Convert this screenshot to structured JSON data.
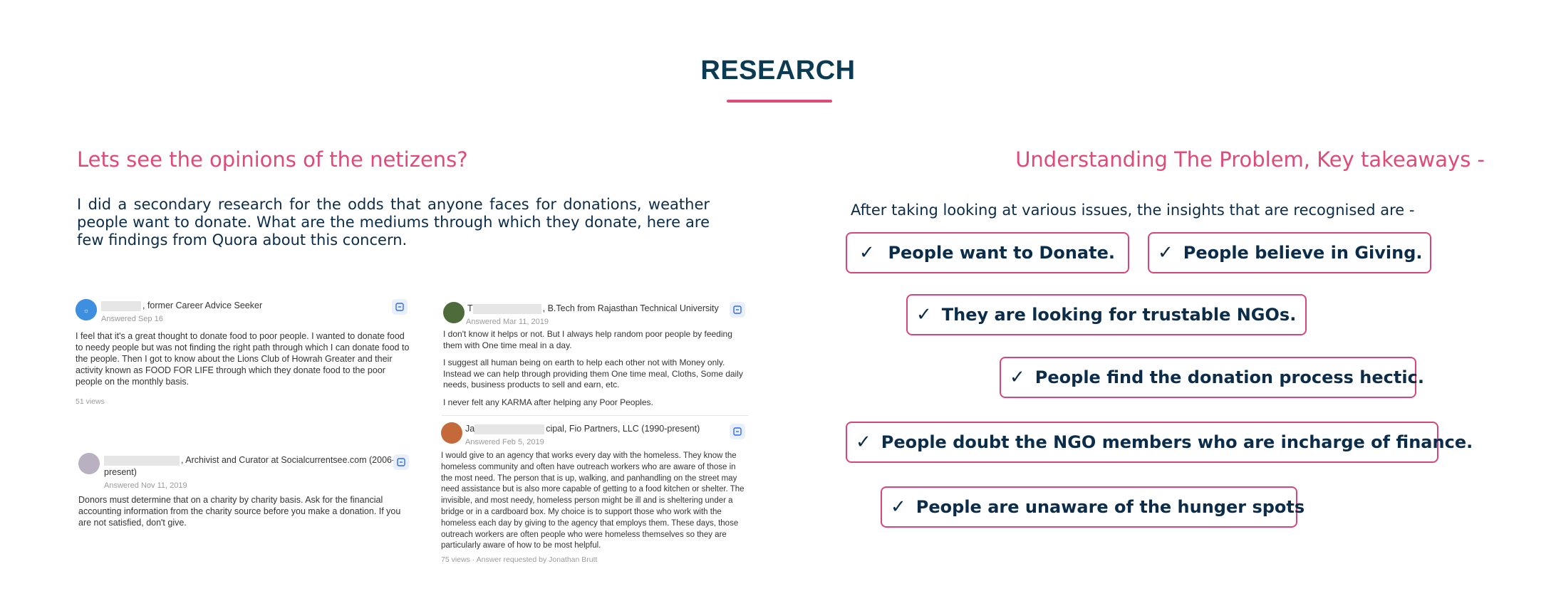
{
  "page": {
    "title": "RESEARCH",
    "accent_color": "#e04a78",
    "text_color": "#0b2d4a"
  },
  "left": {
    "heading": "Lets see the opinions of the netizens?",
    "intro": "I did a secondary research for the odds that anyone faces for donations, weather people want to donate. What are the mediums through which they donate, here are few findings from Quora about this concern."
  },
  "right": {
    "heading": "Understanding The Problem, Key takeaways -",
    "intro": "After taking looking at various issues, the insights that are recognised are -",
    "check_symbol": "✓",
    "insights": [
      "People want to Donate.",
      "People believe in Giving.",
      "They are looking for trustable NGOs.",
      "People find the donation process hectic.",
      "People doubt the NGO members who are incharge of finance.",
      "People are unaware of the hunger spots"
    ]
  },
  "answers": [
    {
      "author": ", former Career Advice Seeker",
      "date": "Answered Sep 16",
      "body": [
        "I feel that it's a great thought to donate food to poor people. I wanted to donate food to needy people but was not finding the right path through which I can donate food to the people. Then I got to know about the Lions Club of Howrah Greater and their activity known as FOOD FOR LIFE through which they donate food to the poor people on the monthly basis."
      ],
      "meta": "51 views"
    },
    {
      "author": ", Archivist and Curator at Socialcurrentsee.com (2006-present)",
      "date": "Answered Nov 11, 2019",
      "body": [
        "Donors must determine that on a charity by charity basis. Ask for the financial accounting information from the charity source before you make a donation. If you are not satisfied, don't give."
      ],
      "meta": ""
    },
    {
      "author_prefix": "T",
      "author": ", B.Tech from Rajasthan Technical University",
      "date": "Answered Mar 11, 2019",
      "body": [
        "I don't know it helps or not. But I always help random poor people by feeding them with One time meal in a day.",
        "I suggest all human being on earth to help each other not with Money only. Instead we can help through providing them One time meal, Cloths, Some daily needs, business products to sell and earn, etc.",
        "I never felt any KARMA after helping any Poor Peoples."
      ],
      "meta": ""
    },
    {
      "author_prefix": "Ja",
      "author": "cipal, Fio Partners, LLC (1990-present)",
      "date": "Answered Feb 5, 2019",
      "body": [
        "I would give to an agency that works every day with the homeless. They know the homeless community and often have outreach workers who are aware of those in the most need. The person that is up, walking, and panhandling on the street may need assistance but is also more capable of getting to a food kitchen or shelter. The invisible, and most needy, homeless person might be ill and is sheltering under a bridge or in a cardboard box. My choice is to support those who work with the homeless each day by giving to the agency that employs them. These days, those outreach workers are often people who were homeless themselves so they are particularly aware of how to be most helpful."
      ],
      "meta": "75 views · Answer requested by Jonathan Brutt"
    }
  ]
}
